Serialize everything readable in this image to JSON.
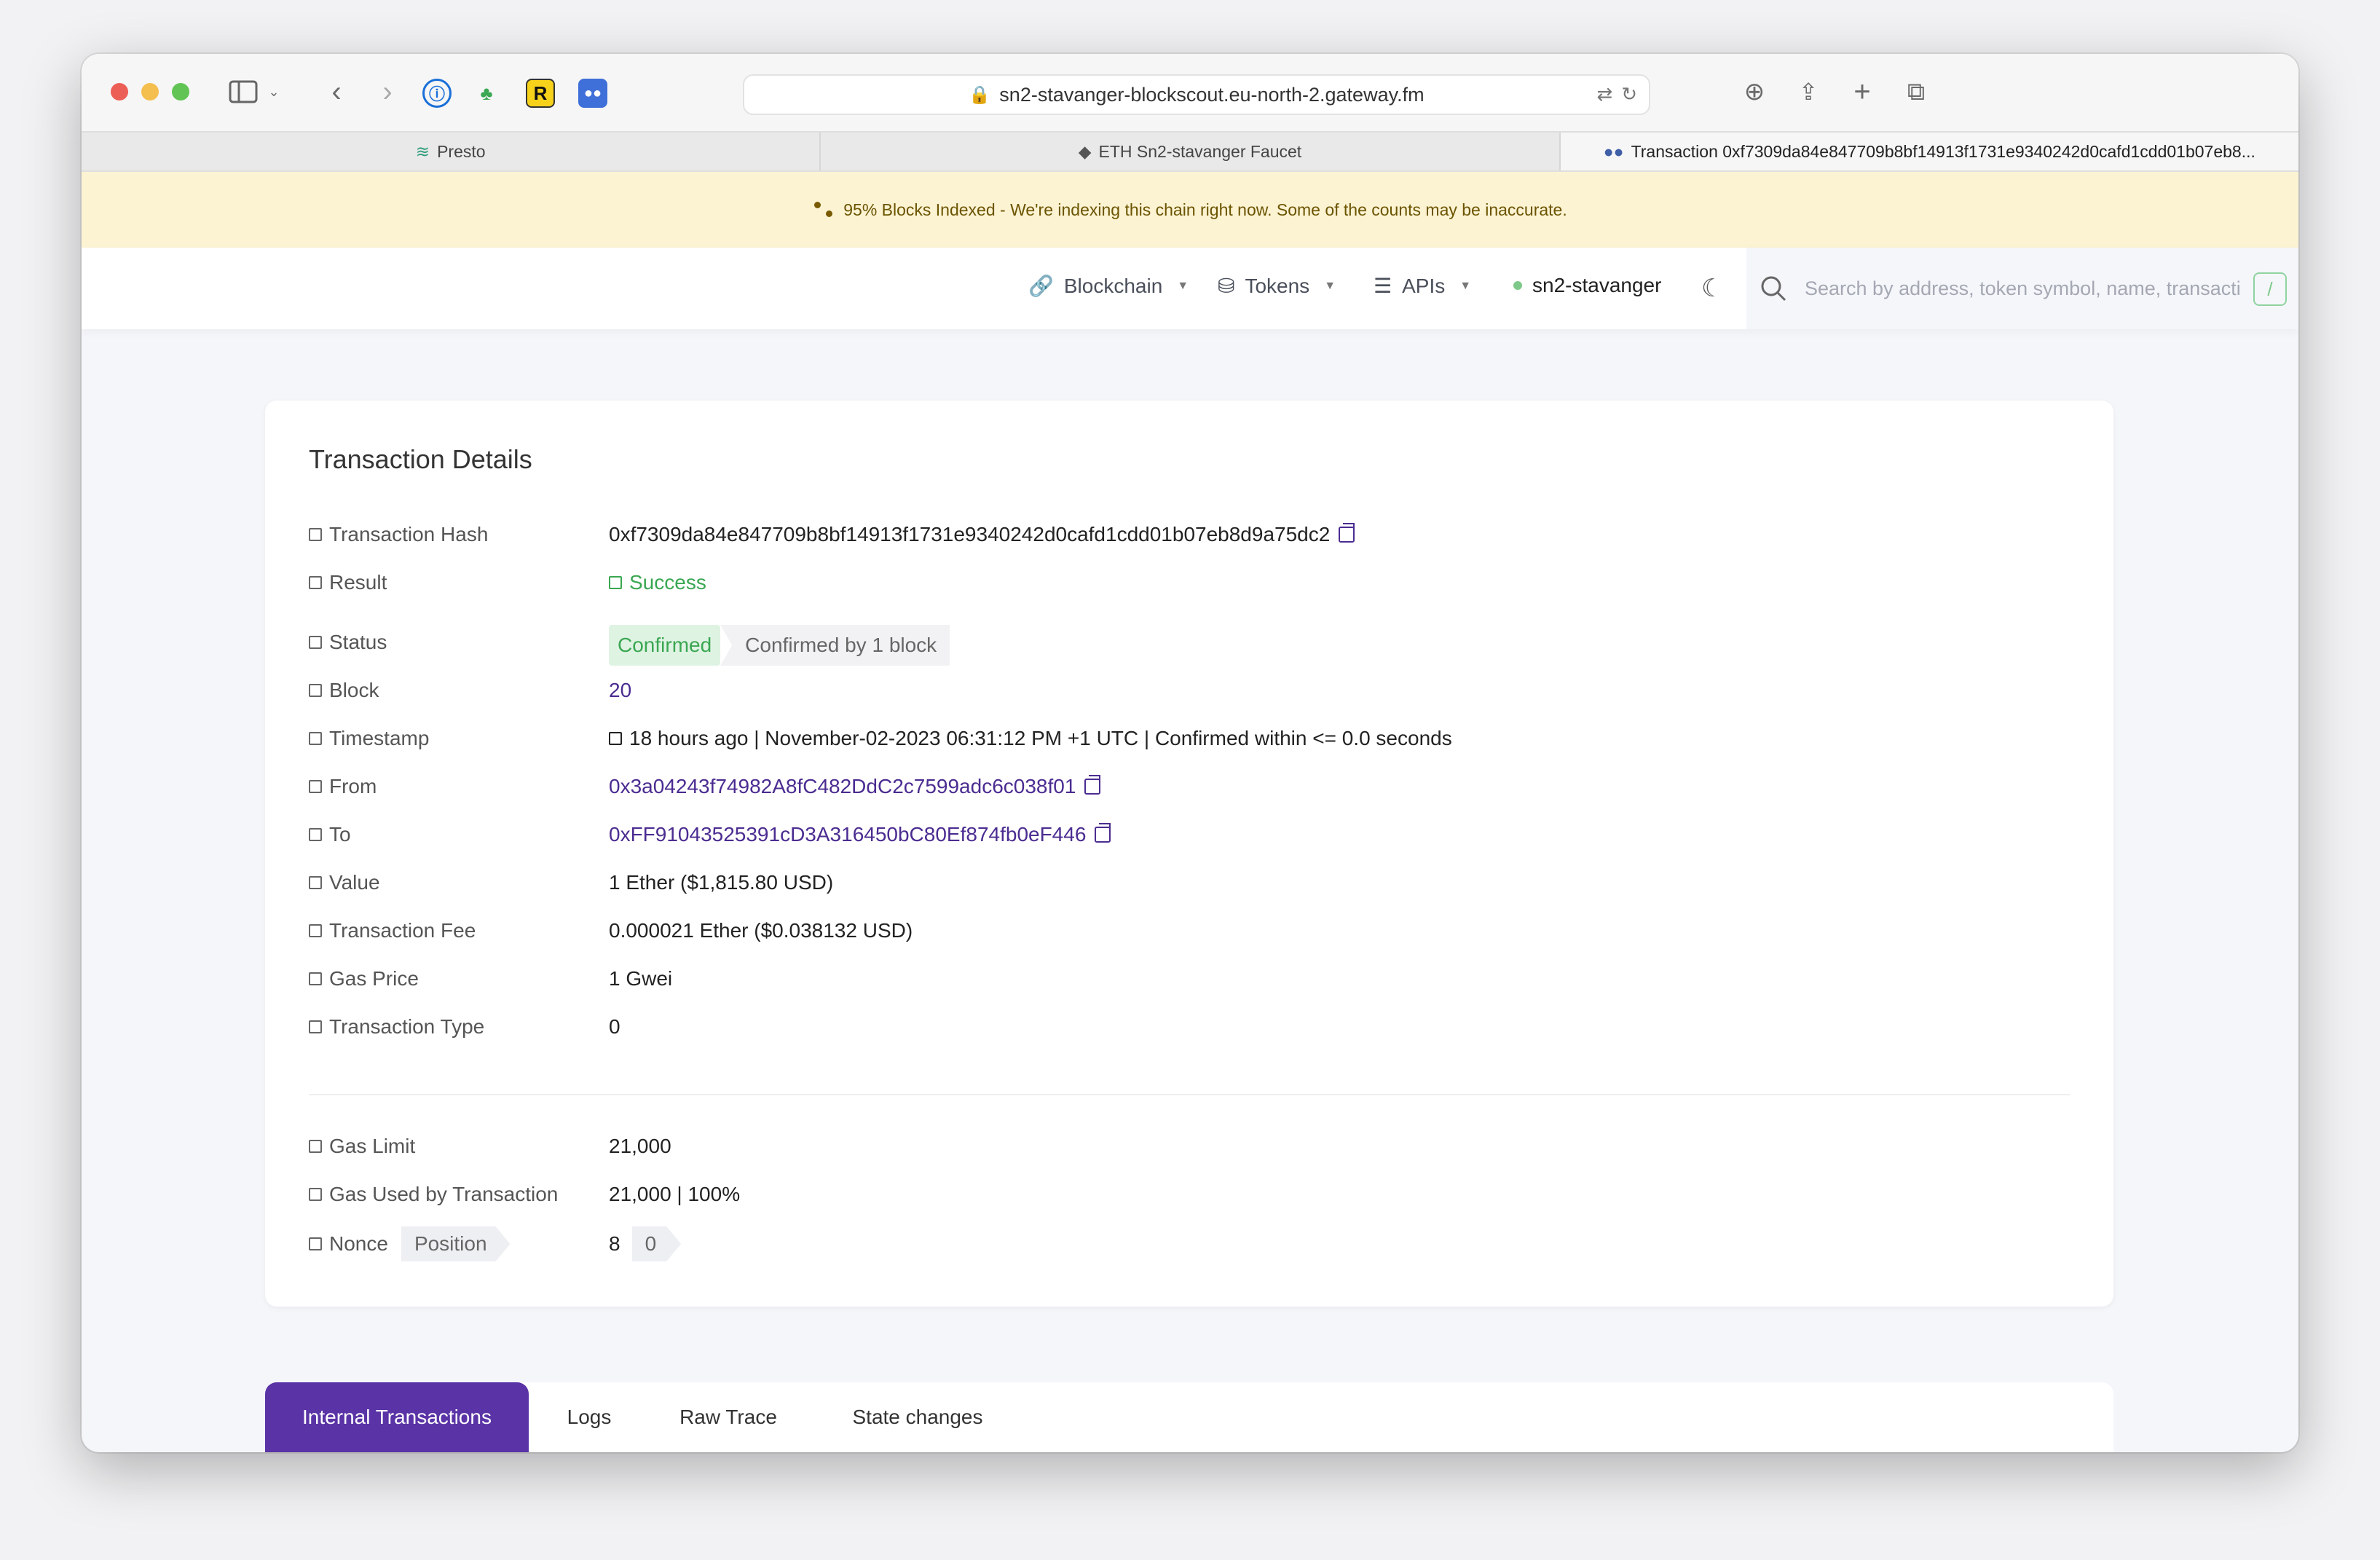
{
  "browser": {
    "url": "sn2-stavanger-blockscout.eu-north-2.gateway.fm",
    "tabs": [
      {
        "label": "Presto"
      },
      {
        "label": "ETH Sn2-stavanger Faucet"
      },
      {
        "label": "Transaction 0xf7309da84e847709b8bf14913f1731e9340242d0cafd1cdd01b07eb8..."
      }
    ],
    "ext_r_label": "R"
  },
  "banner": {
    "text": "95% Blocks Indexed - We're indexing this chain right now. Some of the counts may be inaccurate."
  },
  "navbar": {
    "blockchain": "Blockchain",
    "tokens": "Tokens",
    "apis": "APIs",
    "network": "sn2-stavanger",
    "search_placeholder": "Search by address, token symbol, name, transacti",
    "search_shortcut": "/"
  },
  "details": {
    "title": "Transaction Details",
    "rows": {
      "hash": {
        "label": "Transaction Hash",
        "value": "0xf7309da84e847709b8bf14913f1731e9340242d0cafd1cdd01b07eb8d9a75dc2"
      },
      "result": {
        "label": "Result",
        "value": "Success"
      },
      "status": {
        "label": "Status",
        "badge": "Confirmed",
        "confirmations": "Confirmed by 1 block"
      },
      "block": {
        "label": "Block",
        "value": "20"
      },
      "timestamp": {
        "label": "Timestamp",
        "value": "18 hours ago | November-02-2023 06:31:12 PM +1 UTC | Confirmed within <= 0.0 seconds"
      },
      "from": {
        "label": "From",
        "value": "0x3a04243f74982A8fC482DdC2c7599adc6c038f01"
      },
      "to": {
        "label": "To",
        "value": "0xFF91043525391cD3A316450bC80Ef874fb0eF446"
      },
      "value": {
        "label": "Value",
        "value": "1 Ether ($1,815.80 USD)"
      },
      "fee": {
        "label": "Transaction Fee",
        "value": "0.000021 Ether ($0.038132 USD)"
      },
      "gas_price": {
        "label": "Gas Price",
        "value": "1 Gwei"
      },
      "tx_type": {
        "label": "Transaction Type",
        "value": "0"
      },
      "gas_limit": {
        "label": "Gas Limit",
        "value": "21,000"
      },
      "gas_used": {
        "label": "Gas Used by Transaction",
        "value": "21,000 | 100%"
      },
      "nonce": {
        "label": "Nonce",
        "position_label": "Position",
        "value": "8",
        "position_value": "0"
      }
    }
  },
  "bottom_tabs": [
    {
      "label": "Internal Transactions"
    },
    {
      "label": "Logs"
    },
    {
      "label": "Raw Trace"
    },
    {
      "label": "State changes"
    }
  ],
  "colors": {
    "accent_purple": "#5a33a6",
    "link_purple": "#4b2c91",
    "success_green": "#3aa752",
    "banner_bg": "#fcf3d3"
  }
}
